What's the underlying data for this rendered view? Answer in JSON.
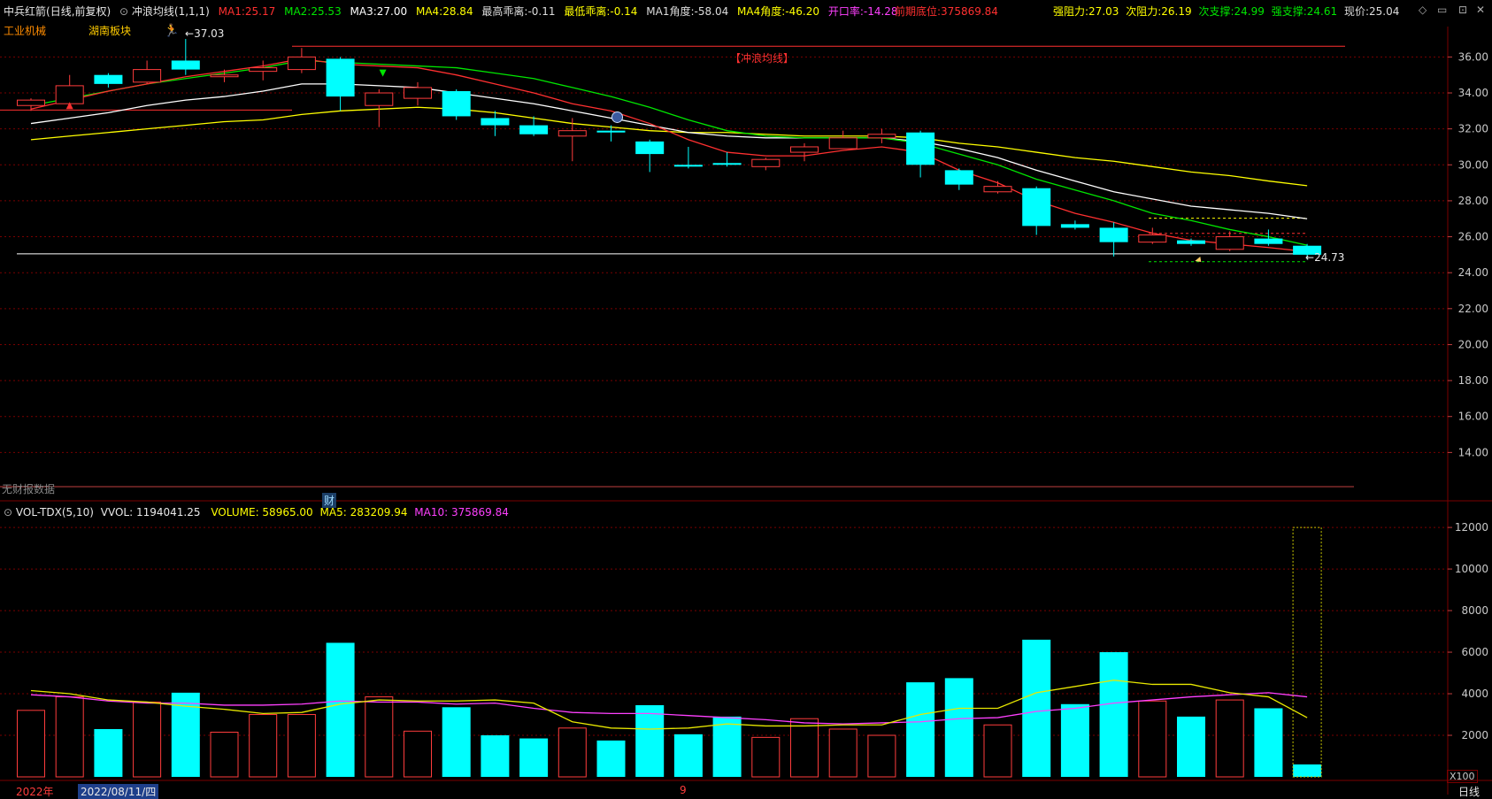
{
  "header": {
    "security": "中兵红箭",
    "period": "(日线,前复权)",
    "indicator": "冲浪均线(1,1,1)",
    "ma1": {
      "label": "MA1:",
      "value": "25.17",
      "color": "#ff3030"
    },
    "ma2": {
      "label": "MA2:",
      "value": "25.53",
      "color": "#00e600"
    },
    "ma3": {
      "label": "MA3:",
      "value": "27.00",
      "color": "#ffffff"
    },
    "ma4": {
      "label": "MA4:",
      "value": "28.84",
      "color": "#ffff00"
    },
    "high_dev": {
      "label": "最高乖离:",
      "value": "-0.11"
    },
    "low_dev": {
      "label": "最低乖离:",
      "value": "-0.14"
    },
    "ma1_angle": {
      "label": "MA1角度:",
      "value": "-58.04"
    },
    "ma4_angle": {
      "label": "MA4角度:",
      "value": "-46.20"
    },
    "open_rate": {
      "label": "开口率:",
      "value": "-14.28"
    },
    "prev_low": {
      "label": "前期底位:",
      "value": "375869.84"
    },
    "strong_res": {
      "label": "强阻力:",
      "value": "27.03"
    },
    "sub_res": {
      "label": "次阻力:",
      "value": "26.19"
    },
    "sub_sup": {
      "label": "次支撑:",
      "value": "24.99"
    },
    "strong_sup": {
      "label": "强支撑:",
      "value": "24.61"
    },
    "price": {
      "label": "现价:",
      "value": "25.04"
    }
  },
  "tags": {
    "industry": "工业机械",
    "region": "湖南板块",
    "high_mark": "37.03",
    "strategy": "【冲浪均线】",
    "low_mark": "24.73",
    "finance_badge": "财",
    "no_data": "无财报数据"
  },
  "volume_header": {
    "name": "VOL-TDX(5,10)",
    "vvol": "VVOL: 1194041.25",
    "volume": "VOLUME: 58965.00",
    "ma5": "MA5: 283209.94",
    "ma10": "MA10: 375869.84"
  },
  "bottom_bar": {
    "year": "2022年",
    "date": "2022/08/11/四",
    "marker": "9",
    "multiplier": "X100",
    "period": "日线"
  },
  "price_axis": [
    "36.00",
    "34.00",
    "32.00",
    "30.00",
    "28.00",
    "26.00",
    "24.00",
    "22.00",
    "20.00",
    "18.00",
    "16.00",
    "14.00"
  ],
  "volume_axis": [
    "12000",
    "10000",
    "8000",
    "6000",
    "4000",
    "2000"
  ],
  "colors": {
    "up": "#ff3c3c",
    "down": "#00ffff",
    "ma5": "#e8e800",
    "ma10": "#ff40ff",
    "bg": "#000000",
    "grid": "#7a0000"
  },
  "chart_data": {
    "type": "candlestick",
    "price_range": [
      12,
      37.2
    ],
    "volume_range": [
      0,
      12600
    ],
    "candles": [
      {
        "o": 33.3,
        "c": 33.6,
        "h": 33.7,
        "l": 33.0,
        "v": 3200,
        "up": true
      },
      {
        "o": 33.4,
        "c": 34.4,
        "h": 35.0,
        "l": 33.2,
        "v": 3850,
        "up": true
      },
      {
        "o": 34.5,
        "c": 35.0,
        "h": 35.1,
        "l": 34.3,
        "v": 2300,
        "up": false
      },
      {
        "o": 34.6,
        "c": 35.3,
        "h": 35.8,
        "l": 34.5,
        "v": 3600,
        "up": true
      },
      {
        "o": 35.3,
        "c": 35.8,
        "h": 37.0,
        "l": 35.0,
        "v": 4050,
        "up": false
      },
      {
        "o": 34.9,
        "c": 35.0,
        "h": 35.3,
        "l": 34.6,
        "v": 2150,
        "up": true
      },
      {
        "o": 35.2,
        "c": 35.4,
        "h": 35.8,
        "l": 34.7,
        "v": 3000,
        "up": true
      },
      {
        "o": 35.3,
        "c": 36.0,
        "h": 36.5,
        "l": 35.1,
        "v": 3000,
        "up": true
      },
      {
        "o": 35.9,
        "c": 33.8,
        "h": 36.0,
        "l": 33.0,
        "v": 6450,
        "up": false
      },
      {
        "o": 33.3,
        "c": 34.0,
        "h": 34.2,
        "l": 32.1,
        "v": 3850,
        "up": true
      },
      {
        "o": 33.7,
        "c": 34.3,
        "h": 34.6,
        "l": 33.3,
        "v": 2200,
        "up": true
      },
      {
        "o": 34.1,
        "c": 32.7,
        "h": 34.2,
        "l": 32.5,
        "v": 3350,
        "up": false
      },
      {
        "o": 32.6,
        "c": 32.2,
        "h": 33.0,
        "l": 31.6,
        "v": 2000,
        "up": false
      },
      {
        "o": 32.2,
        "c": 31.7,
        "h": 32.7,
        "l": 31.6,
        "v": 1850,
        "up": false
      },
      {
        "o": 31.6,
        "c": 31.9,
        "h": 32.6,
        "l": 30.2,
        "v": 2350,
        "up": true
      },
      {
        "o": 31.9,
        "c": 31.8,
        "h": 32.2,
        "l": 31.3,
        "v": 1750,
        "up": false
      },
      {
        "o": 31.3,
        "c": 30.6,
        "h": 31.4,
        "l": 29.6,
        "v": 3450,
        "up": false
      },
      {
        "o": 30.0,
        "c": 29.9,
        "h": 31.0,
        "l": 29.8,
        "v": 2050,
        "up": false
      },
      {
        "o": 30.1,
        "c": 30.0,
        "h": 30.7,
        "l": 29.9,
        "v": 2900,
        "up": false
      },
      {
        "o": 29.9,
        "c": 30.3,
        "h": 30.4,
        "l": 29.7,
        "v": 1900,
        "up": true
      },
      {
        "o": 30.7,
        "c": 31.0,
        "h": 31.2,
        "l": 30.2,
        "v": 2800,
        "up": true
      },
      {
        "o": 30.9,
        "c": 31.5,
        "h": 31.9,
        "l": 30.9,
        "v": 2300,
        "up": true
      },
      {
        "o": 31.5,
        "c": 31.7,
        "h": 32.0,
        "l": 31.2,
        "v": 2000,
        "up": true
      },
      {
        "o": 31.8,
        "c": 30.0,
        "h": 31.9,
        "l": 29.3,
        "v": 4550,
        "up": false
      },
      {
        "o": 29.7,
        "c": 28.9,
        "h": 29.8,
        "l": 28.6,
        "v": 4750,
        "up": false
      },
      {
        "o": 28.5,
        "c": 28.8,
        "h": 29.1,
        "l": 28.4,
        "v": 2500,
        "up": true
      },
      {
        "o": 28.7,
        "c": 26.6,
        "h": 28.8,
        "l": 26.1,
        "v": 6600,
        "up": false
      },
      {
        "o": 26.7,
        "c": 26.5,
        "h": 26.9,
        "l": 26.4,
        "v": 3500,
        "up": false
      },
      {
        "o": 26.5,
        "c": 25.7,
        "h": 26.8,
        "l": 24.9,
        "v": 6000,
        "up": false
      },
      {
        "o": 25.7,
        "c": 26.1,
        "h": 26.5,
        "l": 25.6,
        "v": 3650,
        "up": true
      },
      {
        "o": 25.8,
        "c": 25.6,
        "h": 25.9,
        "l": 25.5,
        "v": 2900,
        "up": false
      },
      {
        "o": 25.3,
        "c": 26.0,
        "h": 26.3,
        "l": 25.2,
        "v": 3700,
        "up": true
      },
      {
        "o": 25.9,
        "c": 25.6,
        "h": 26.4,
        "l": 25.5,
        "v": 3300,
        "up": false
      },
      {
        "o": 25.5,
        "c": 25.0,
        "h": 25.6,
        "l": 24.73,
        "v": 600,
        "up": false
      }
    ],
    "ma1": [
      33.1,
      33.6,
      34.1,
      34.5,
      34.9,
      35.2,
      35.5,
      35.9,
      35.6,
      35.5,
      35.4,
      35.0,
      34.5,
      34.0,
      33.4,
      33.0,
      32.3,
      31.4,
      30.7,
      30.5,
      30.5,
      30.8,
      31.0,
      30.7,
      29.7,
      29.0,
      28.0,
      27.3,
      26.8,
      26.2,
      25.8,
      25.6,
      25.4,
      25.17
    ],
    "ma2": [
      33.3,
      33.7,
      34.1,
      34.5,
      34.8,
      35.1,
      35.4,
      35.8,
      35.7,
      35.6,
      35.5,
      35.4,
      35.1,
      34.8,
      34.3,
      33.8,
      33.2,
      32.5,
      31.9,
      31.6,
      31.5,
      31.5,
      31.5,
      31.2,
      30.6,
      30.0,
      29.2,
      28.6,
      28.0,
      27.3,
      26.9,
      26.4,
      26.0,
      25.53
    ],
    "ma3": [
      32.3,
      32.6,
      32.9,
      33.3,
      33.6,
      33.8,
      34.1,
      34.5,
      34.5,
      34.4,
      34.3,
      34.0,
      33.7,
      33.4,
      33.0,
      32.6,
      32.2,
      31.8,
      31.6,
      31.5,
      31.5,
      31.5,
      31.5,
      31.3,
      30.9,
      30.4,
      29.7,
      29.1,
      28.5,
      28.1,
      27.7,
      27.5,
      27.3,
      27.0
    ],
    "ma4": [
      31.4,
      31.6,
      31.8,
      32.0,
      32.2,
      32.4,
      32.5,
      32.8,
      33.0,
      33.1,
      33.2,
      33.1,
      32.9,
      32.6,
      32.3,
      32.1,
      31.9,
      31.8,
      31.8,
      31.7,
      31.6,
      31.6,
      31.6,
      31.5,
      31.2,
      31.0,
      30.7,
      30.4,
      30.2,
      29.9,
      29.6,
      29.4,
      29.1,
      28.84
    ],
    "vol_ma5": [
      4150,
      4000,
      3700,
      3600,
      3400,
      3250,
      3050,
      3100,
      3500,
      3700,
      3650,
      3650,
      3700,
      3550,
      2650,
      2350,
      2300,
      2350,
      2550,
      2450,
      2450,
      2500,
      2500,
      3000,
      3300,
      3300,
      4050,
      4350,
      4650,
      4450,
      4450,
      4050,
      3850,
      2850
    ],
    "vol_ma10": [
      3950,
      3850,
      3650,
      3550,
      3550,
      3450,
      3450,
      3500,
      3650,
      3600,
      3600,
      3500,
      3550,
      3300,
      3100,
      3050,
      3050,
      2950,
      2850,
      2750,
      2600,
      2550,
      2600,
      2650,
      2800,
      2850,
      3150,
      3300,
      3550,
      3700,
      3850,
      3950,
      4050,
      3850
    ]
  }
}
